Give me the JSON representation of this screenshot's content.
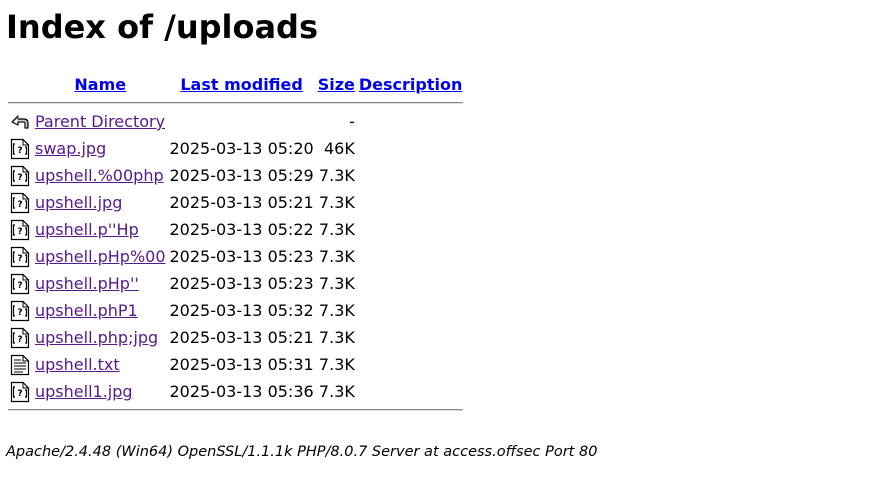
{
  "title": "Index of /uploads",
  "columns": {
    "name": "Name",
    "last_modified": "Last modified",
    "size": "Size",
    "description": "Description"
  },
  "parent": {
    "label": "Parent Directory",
    "size": "-",
    "icon": "back-icon"
  },
  "rows": [
    {
      "name": "swap.jpg",
      "modified": "2025-03-13 05:20",
      "size": "46K",
      "icon": "unknown-file-icon"
    },
    {
      "name": "upshell.%00php",
      "modified": "2025-03-13 05:29",
      "size": "7.3K",
      "icon": "unknown-file-icon"
    },
    {
      "name": "upshell.jpg",
      "modified": "2025-03-13 05:21",
      "size": "7.3K",
      "icon": "unknown-file-icon"
    },
    {
      "name": "upshell.p''Hp",
      "modified": "2025-03-13 05:22",
      "size": "7.3K",
      "icon": "unknown-file-icon"
    },
    {
      "name": "upshell.pHp%00",
      "modified": "2025-03-13 05:23",
      "size": "7.3K",
      "icon": "unknown-file-icon"
    },
    {
      "name": "upshell.pHp''",
      "modified": "2025-03-13 05:23",
      "size": "7.3K",
      "icon": "unknown-file-icon"
    },
    {
      "name": "upshell.phP1",
      "modified": "2025-03-13 05:32",
      "size": "7.3K",
      "icon": "unknown-file-icon"
    },
    {
      "name": "upshell.php;jpg",
      "modified": "2025-03-13 05:21",
      "size": "7.3K",
      "icon": "unknown-file-icon"
    },
    {
      "name": "upshell.txt",
      "modified": "2025-03-13 05:31",
      "size": "7.3K",
      "icon": "text-file-icon"
    },
    {
      "name": "upshell1.jpg",
      "modified": "2025-03-13 05:36",
      "size": "7.3K",
      "icon": "unknown-file-icon"
    }
  ],
  "footer": "Apache/2.4.48 (Win64) OpenSSL/1.1.1k PHP/8.0.7 Server at access.offsec Port 80"
}
